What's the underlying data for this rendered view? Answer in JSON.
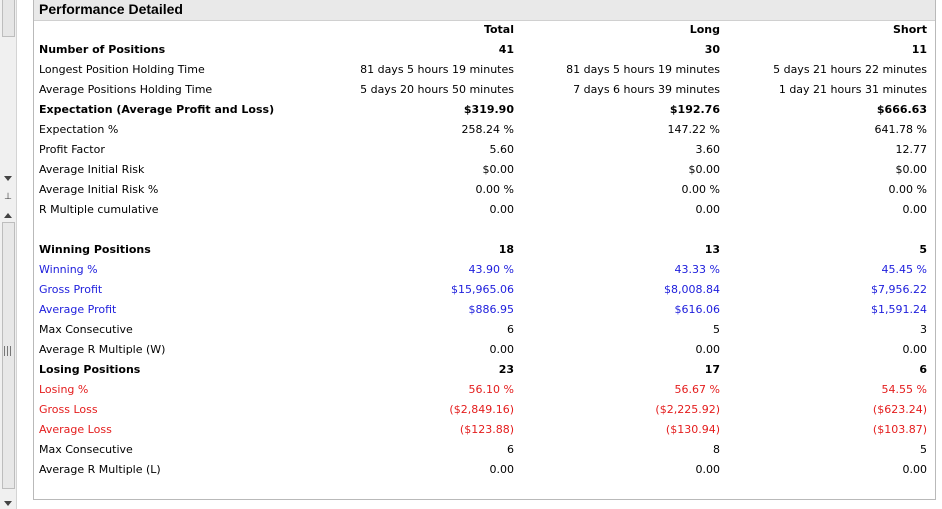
{
  "panel": {
    "title": "Performance Detailed"
  },
  "columns": {
    "total": "Total",
    "long": "Long",
    "short": "Short"
  },
  "colors": {
    "normal": "#000000",
    "winning": "#1d1ddc",
    "losing": "#e41d1d",
    "header_bg": "#e9e9e9"
  },
  "icons": {
    "scroll_down": "chevron-down-icon",
    "pin": "pin-icon",
    "scroll_up": "chevron-up-icon",
    "grip": "grip-icon"
  },
  "rows": [
    {
      "label": "Number of Positions",
      "total": "41",
      "long": "30",
      "short": "11",
      "style": "bold"
    },
    {
      "label": "Longest Position Holding Time",
      "total": "81 days 5 hours 19 minutes",
      "long": "81 days 5 hours 19 minutes",
      "short": "5 days 21 hours 22 minutes",
      "style": "normal"
    },
    {
      "label": "Average Positions Holding Time",
      "total": "5 days 20 hours 50 minutes",
      "long": "7 days 6 hours 39 minutes",
      "short": "1 day 21 hours 31 minutes",
      "style": "normal"
    },
    {
      "label": "Expectation (Average Profit and Loss)",
      "total": "$319.90",
      "long": "$192.76",
      "short": "$666.63",
      "style": "bold"
    },
    {
      "label": "Expectation %",
      "total": "258.24 %",
      "long": "147.22 %",
      "short": "641.78 %",
      "style": "normal"
    },
    {
      "label": "Profit Factor",
      "total": "5.60",
      "long": "3.60",
      "short": "12.77",
      "style": "normal"
    },
    {
      "label": "Average Initial Risk",
      "total": "$0.00",
      "long": "$0.00",
      "short": "$0.00",
      "style": "normal"
    },
    {
      "label": "Average Initial Risk %",
      "total": "0.00 %",
      "long": "0.00 %",
      "short": "0.00 %",
      "style": "normal"
    },
    {
      "label": "R Multiple cumulative",
      "total": "0.00",
      "long": "0.00",
      "short": "0.00",
      "style": "normal"
    },
    {
      "label": "",
      "total": "",
      "long": "",
      "short": "",
      "style": "normal"
    },
    {
      "label": "Winning Positions",
      "total": "18",
      "long": "13",
      "short": "5",
      "style": "bold"
    },
    {
      "label": "Winning %",
      "total": "43.90 %",
      "long": "43.33 %",
      "short": "45.45 %",
      "style": "blue"
    },
    {
      "label": "Gross Profit",
      "total": "$15,965.06",
      "long": "$8,008.84",
      "short": "$7,956.22",
      "style": "blue"
    },
    {
      "label": "Average Profit",
      "total": "$886.95",
      "long": "$616.06",
      "short": "$1,591.24",
      "style": "blue"
    },
    {
      "label": "Max Consecutive",
      "total": "6",
      "long": "5",
      "short": "3",
      "style": "normal"
    },
    {
      "label": "Average R Multiple (W)",
      "total": "0.00",
      "long": "0.00",
      "short": "0.00",
      "style": "normal"
    },
    {
      "label": "Losing Positions",
      "total": "23",
      "long": "17",
      "short": "6",
      "style": "bold"
    },
    {
      "label": "Losing %",
      "total": "56.10 %",
      "long": "56.67 %",
      "short": "54.55 %",
      "style": "red"
    },
    {
      "label": "Gross Loss",
      "total": "($2,849.16)",
      "long": "($2,225.92)",
      "short": "($623.24)",
      "style": "red"
    },
    {
      "label": "Average Loss",
      "total": "($123.88)",
      "long": "($130.94)",
      "short": "($103.87)",
      "style": "red"
    },
    {
      "label": "Max Consecutive",
      "total": "6",
      "long": "8",
      "short": "5",
      "style": "normal"
    },
    {
      "label": "Average R Multiple (L)",
      "total": "0.00",
      "long": "0.00",
      "short": "0.00",
      "style": "normal"
    }
  ]
}
